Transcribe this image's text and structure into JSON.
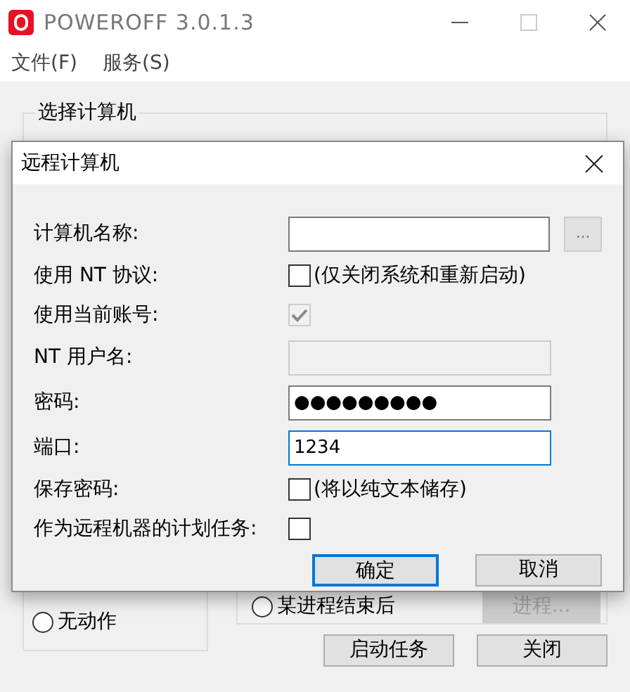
{
  "window": {
    "title": "POWEROFF 3.0.1.3"
  },
  "menu": [
    {
      "label": "文件(F)"
    },
    {
      "label": "服务(S)"
    }
  ],
  "computer_group": {
    "title": "选择计算机"
  },
  "action_group": {
    "options": [
      {
        "label": "无动作",
        "selected": false
      }
    ]
  },
  "schedule_group": {
    "options": [
      {
        "label": "某进程结束后",
        "selected": false
      }
    ],
    "button": {
      "label": "进程...",
      "disabled": true
    }
  },
  "buttons": [
    "启动任务",
    "关闭"
  ],
  "dialog": {
    "title": "远程计算机",
    "rows": [
      {
        "kind": "field",
        "label": "计算机名称:",
        "browse_button": "...",
        "disabled": false,
        "focused": false
      },
      {
        "kind": "checkbox",
        "label": "使用 NT 协议:",
        "checked": false,
        "disabled": false,
        "note": "(仅关闭系统和重新启动)"
      },
      {
        "kind": "checkbox",
        "label": "使用当前账号:",
        "checked": true,
        "disabled": true
      },
      {
        "kind": "field",
        "label": "NT 用户名:",
        "disabled": true,
        "focused": false
      },
      {
        "kind": "field",
        "label": "密码:",
        "value": "●●●●●●●●●",
        "disabled": false,
        "focused": false
      },
      {
        "kind": "field",
        "label": "端口:",
        "value": "1234",
        "disabled": false,
        "focused": true
      },
      {
        "kind": "checkbox",
        "label": "保存密码:",
        "checked": false,
        "disabled": false,
        "note": "(将以纯文本储存)"
      },
      {
        "kind": "checkbox",
        "label": "作为远程机器的计划任务:",
        "checked": false,
        "disabled": false
      }
    ],
    "buttons": [
      {
        "label": "确定",
        "default": true
      },
      {
        "label": "取消",
        "default": false
      }
    ]
  }
}
